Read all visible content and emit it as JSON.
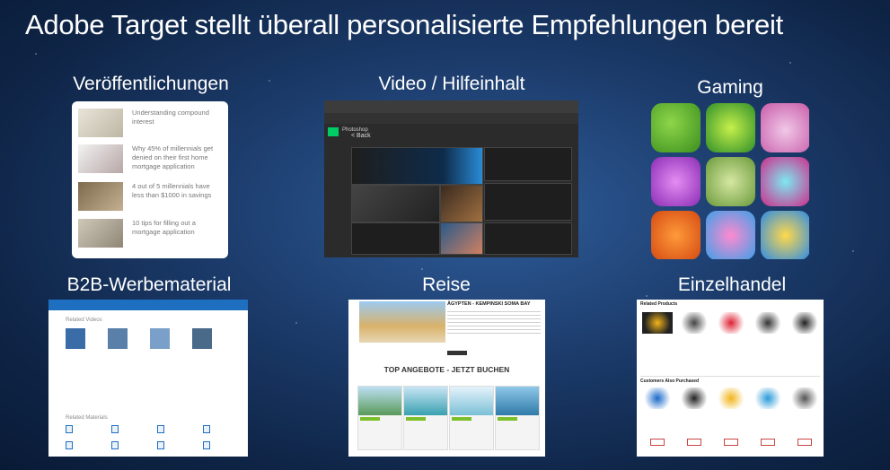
{
  "title": "Adobe Target stellt überall personalisierte Empfehlungen bereit",
  "labels": {
    "publications": "Veröffentlichungen",
    "video": "Video / Hilfeinhalt",
    "gaming": "Gaming",
    "b2b": "B2B-Werbematerial",
    "travel": "Reise",
    "retail": "Einzelhandel"
  },
  "publications": {
    "items": [
      "Understanding compound interest",
      "Why 45% of millennials get denied on their first home mortgage application",
      "4 out of 5 millennials have less than $1000 in savings",
      "10 tips for filling out a mortgage application"
    ]
  },
  "video": {
    "app": "Photoshop",
    "back": "< Back"
  },
  "b2b": {
    "related_videos": "Related Videos",
    "related_materials": "Related Materials"
  },
  "travel": {
    "headline": "ÄGYPTEN - KEMPINSKI SOMA BAY",
    "offers": "TOP ANGEBOTE - JETZT BUCHEN"
  },
  "retail": {
    "related_products": "Related Products",
    "customers_also": "Customers Also Purchased"
  },
  "colors": {
    "background": "#1c3c6c",
    "b2b_blue": "#1f6fc0",
    "travel_green": "#7bbf2a"
  }
}
